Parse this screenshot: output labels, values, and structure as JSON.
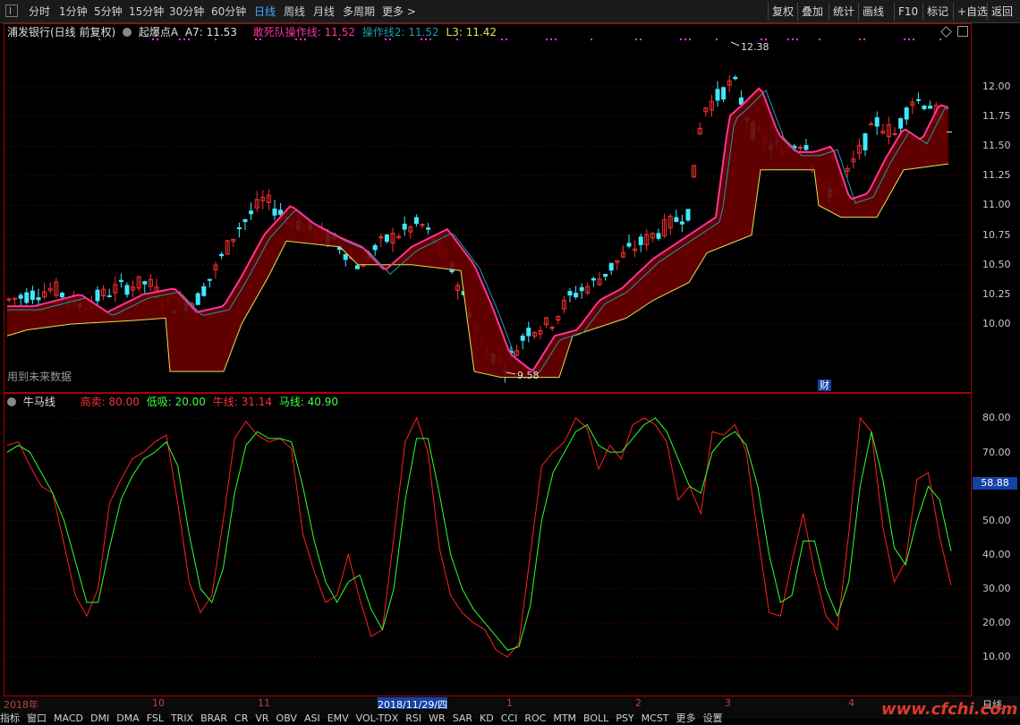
{
  "toolbar": {
    "periods": [
      "分时",
      "1分钟",
      "5分钟",
      "15分钟",
      "30分钟",
      "60分钟",
      "日线",
      "周线",
      "月线",
      "多周期",
      "更多 >"
    ],
    "active_period": "日线",
    "right_buttons": [
      "复权",
      "叠加",
      "统计",
      "画线",
      "F10",
      "标记",
      "+自选",
      "返回"
    ]
  },
  "main": {
    "stock_label": "浦发银行(日线 前复权)",
    "indicator_name": "起爆点A",
    "a7": "A7: 11.53",
    "line1": "敢死队操作线: 11.52",
    "line2": "操作线2: 11.52",
    "l3": "L3: 11.42",
    "future_note": "用到未来数据",
    "high_label": "12.38",
    "low_label": "9.58",
    "cai_badge": "财",
    "price_ticks": [
      "12.00",
      "11.75",
      "11.50",
      "11.25",
      "11.00",
      "10.75",
      "10.50",
      "10.25",
      "10.00"
    ],
    "colors": {
      "up": "#ff3030",
      "down": "#40e8ff",
      "ma1": "#ff3399",
      "ma2": "#1e9aaa",
      "support": "#e8e050",
      "fill": "#6a0000"
    }
  },
  "sub": {
    "name": "牛马线",
    "high_sell": "高卖: 80.00",
    "low_buy": "低吸: 20.00",
    "niu": "牛线: 31.14",
    "ma": "马线: 40.90",
    "ticks": [
      "80.00",
      "70.00",
      "60.00",
      "50.00",
      "40.00",
      "30.00",
      "20.00",
      "10.00"
    ],
    "price_box": "58.88"
  },
  "chart_data": {
    "type": "line",
    "title": "牛马线",
    "x": [
      "2018年",
      "10",
      "11",
      "2018/11/29/四",
      "1",
      "2",
      "3",
      "4"
    ],
    "ylim": [
      5,
      85
    ],
    "series": [
      {
        "name": "牛线",
        "values": [
          72,
          73,
          66,
          60,
          58,
          43,
          28,
          22,
          30,
          55,
          62,
          68,
          70,
          73,
          75,
          55,
          32,
          23,
          28,
          50,
          74,
          79,
          75,
          73,
          74,
          71,
          46,
          35,
          26,
          28,
          40,
          27,
          16,
          18,
          45,
          73,
          80,
          70,
          42,
          28,
          23,
          20,
          18,
          12,
          10,
          14,
          40,
          66,
          70,
          73,
          80,
          77,
          65,
          72,
          68,
          78,
          80,
          78,
          73,
          56,
          60,
          52,
          76,
          75,
          78,
          70,
          46,
          23,
          22,
          38,
          52,
          35,
          22,
          18,
          46,
          80,
          76,
          48,
          32,
          38,
          62,
          64,
          45,
          31
        ]
      },
      {
        "name": "马线",
        "values": [
          70,
          72,
          70,
          64,
          58,
          50,
          38,
          26,
          26,
          42,
          56,
          63,
          68,
          70,
          73,
          66,
          46,
          30,
          26,
          36,
          58,
          72,
          76,
          74,
          74,
          73,
          60,
          44,
          32,
          26,
          32,
          34,
          24,
          18,
          30,
          56,
          74,
          74,
          58,
          40,
          30,
          24,
          20,
          16,
          12,
          13,
          25,
          50,
          64,
          70,
          76,
          78,
          72,
          70,
          70,
          74,
          78,
          80,
          76,
          68,
          60,
          58,
          70,
          74,
          76,
          72,
          60,
          40,
          26,
          28,
          44,
          44,
          30,
          22,
          32,
          60,
          76,
          62,
          42,
          37,
          50,
          60,
          56,
          41
        ]
      }
    ],
    "reference_lines": [
      80,
      20
    ]
  },
  "footer": {
    "dates": [
      "2018年",
      "10",
      "11",
      "2018/11/29/四",
      "1",
      "2",
      "3",
      "4",
      "日线"
    ],
    "tabs": [
      "指标",
      "窗口",
      "MACD",
      "DMI",
      "DMA",
      "FSL",
      "TRIX",
      "BRAR",
      "CR",
      "VR",
      "OBV",
      "ASI",
      "EMV",
      "VOL-TDX",
      "RSI",
      "WR",
      "SAR",
      "KD",
      "CCI",
      "ROC",
      "MTM",
      "BOLL",
      "PSY",
      "MCST",
      "更多",
      "设置"
    ],
    "watermark": "www.cfchi.com"
  }
}
